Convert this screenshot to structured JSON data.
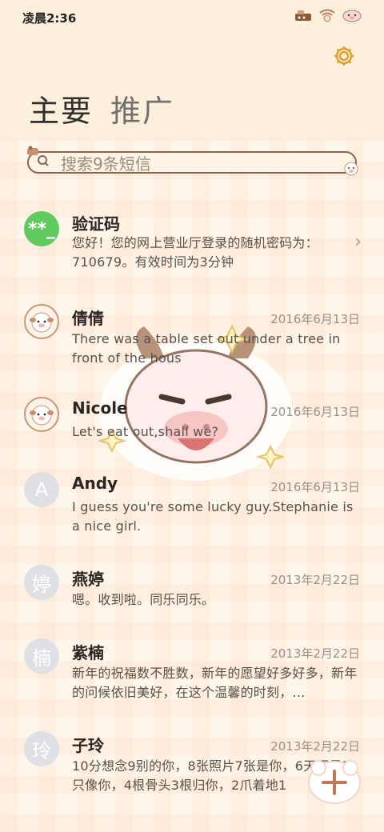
{
  "status_bar": {
    "time": "凌晨2:36"
  },
  "tabs": [
    {
      "label": "主要",
      "active": true
    },
    {
      "label": "推广",
      "active": false
    }
  ],
  "search": {
    "placeholder": "搜索9条短信"
  },
  "conversations": [
    {
      "name": "验证码",
      "avatar_text": "**_",
      "avatar_type": "green",
      "date": "",
      "preview": "您好！您的网上营业厅登录的随机密码为：710679。有效时间为3分钟"
    },
    {
      "name": "倩倩",
      "avatar_type": "photo",
      "date": "2016年6月13日",
      "preview": "There was a table set out under a tree in front of the hous"
    },
    {
      "name": "Nicole",
      "avatar_type": "photo",
      "date": "2016年6月13日",
      "preview": "Let's eat out,shall we?"
    },
    {
      "name": "Andy",
      "avatar_text": "A",
      "avatar_type": "letter",
      "date": "2016年6月13日",
      "preview": "I guess you're some lucky guy.Stephanie is a nice girl."
    },
    {
      "name": "燕婷",
      "avatar_text": "婷",
      "avatar_type": "letter",
      "date": "2013年2月22日",
      "preview": "嗯。收到啦。同乐同乐。"
    },
    {
      "name": "紫楠",
      "avatar_text": "楠",
      "avatar_type": "letter",
      "date": "2013年2月22日",
      "preview": "新年的祝福数不胜数，新年的愿望好多好多，新年的问候依旧美好，在这个温馨的时刻，…"
    },
    {
      "name": "子玲",
      "avatar_text": "玲",
      "avatar_type": "letter",
      "date": "2013年2月22日",
      "preview": "10分想念9别的你，8张照片7张是你，6天不见5只像你，4根骨头3根归你，2爪着地1"
    }
  ],
  "colors": {
    "accent": "#e0a030",
    "avatar_green": "#5fcb5f",
    "avatar_gray": "#dfe0e6",
    "search_border": "#8a6650"
  },
  "icons": {
    "settings": "gear-icon",
    "search": "search-icon",
    "compose": "plus-icon",
    "chevron": "chevron-right-icon"
  }
}
